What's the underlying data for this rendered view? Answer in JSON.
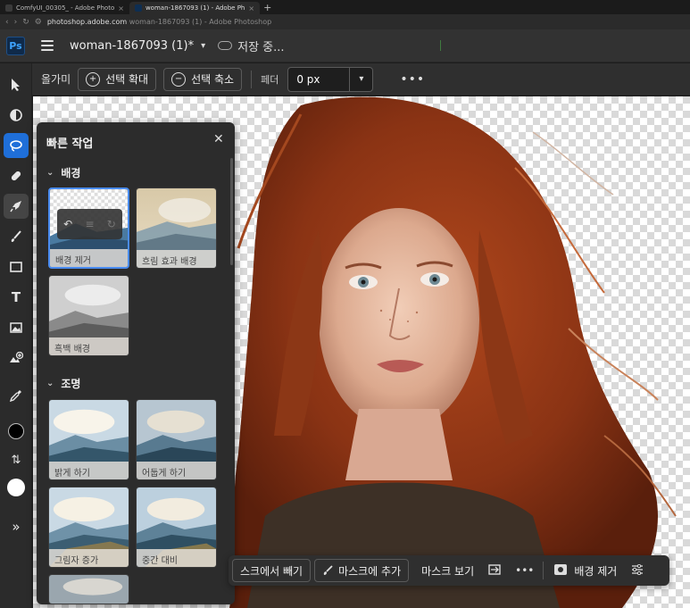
{
  "browser": {
    "tabs": [
      {
        "label": "ComfyUI_00305_ - Adobe Photo",
        "active": false
      },
      {
        "label": "woman-1867093 (1) - Adobe Ph",
        "active": true
      }
    ],
    "new_tab": "+",
    "url_host": "photoshop.adobe.com",
    "url_rest": "woman-1867093 (1) - Adobe Photoshop"
  },
  "header": {
    "logo": "Ps",
    "document_name": "woman-1867093 (1)*",
    "save_status": "저장 중..."
  },
  "options_bar": {
    "tool_name": "올가미",
    "expand_label": "선택 확대",
    "contract_label": "선택 축소",
    "feather_label": "페더",
    "feather_value": "0 px",
    "more": "•••"
  },
  "quick_actions": {
    "title": "빠른 작업",
    "close": "✕",
    "sections": [
      {
        "title": "배경",
        "cards": [
          "배경 제거",
          "흐림 효과 배경",
          "흑백 배경"
        ]
      },
      {
        "title": "조명",
        "cards": [
          "밝게 하기",
          "어둡게 하기",
          "그림자 증가",
          "중간 대비"
        ]
      }
    ]
  },
  "context_bar": {
    "subtract_label": "스크에서 빼기",
    "add_label": "마스크에 추가",
    "view_label": "마스크 보기",
    "more": "•••",
    "remove_bg_label": "배경 제거"
  },
  "colors": {
    "accent_blue": "#1f6fd9",
    "selection_border": "#4a8cf0",
    "panel_bg": "#2c2c2c",
    "app_bg": "#1e1e1e"
  },
  "icons": {
    "tools": [
      "select-arrow-icon",
      "adjust-icon",
      "lasso-icon",
      "healing-icon",
      "quick-action-icon",
      "brush-icon",
      "rectangle-icon",
      "type-icon",
      "place-image-icon",
      "add-image-icon",
      "eyedropper-icon",
      "foreground-color",
      "swap-colors-icon",
      "background-color",
      "expand-toolbar-icon"
    ]
  }
}
